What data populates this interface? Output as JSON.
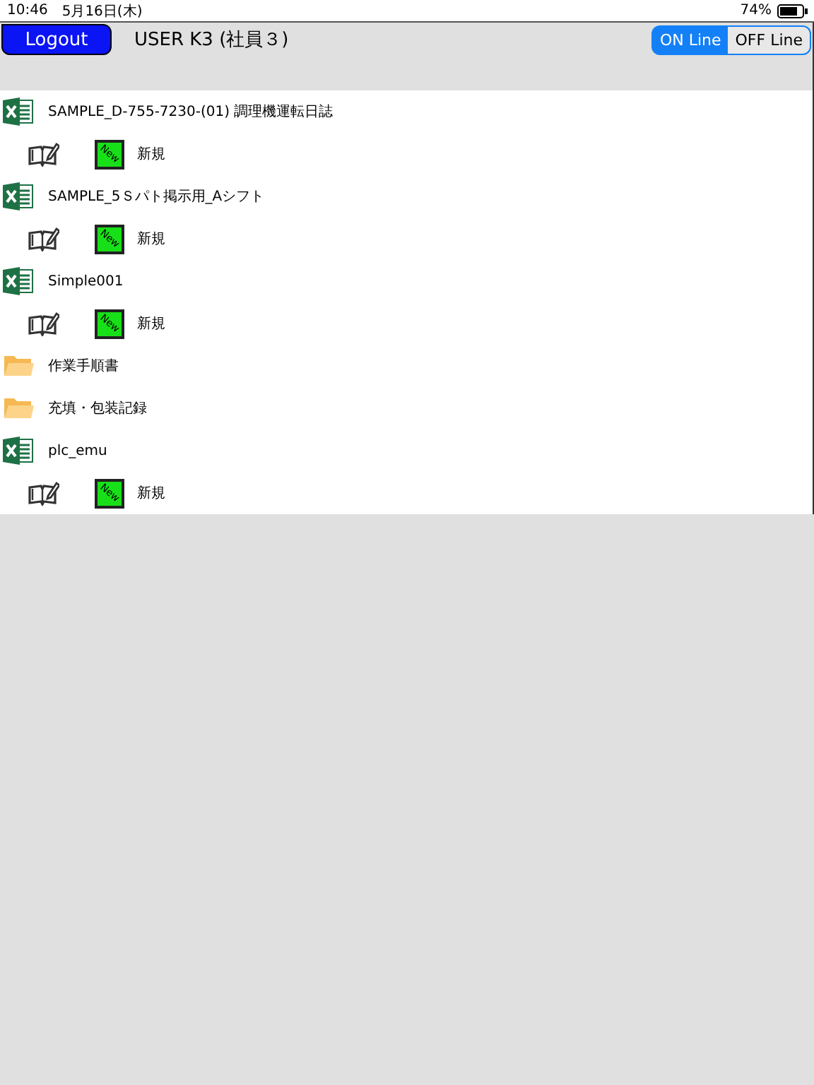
{
  "status_bar": {
    "time": "10:46",
    "date": "5月16日(木)",
    "battery": "74%"
  },
  "header": {
    "logout": "Logout",
    "user": "USER K3 (社員３)",
    "mode_tabs": [
      {
        "label": "ON Line",
        "selected": true
      },
      {
        "label": "OFF Line",
        "selected": false
      }
    ]
  },
  "items": [
    {
      "kind": "file",
      "name": "SAMPLE_D-755-7230-(01) 調理機運転日誌",
      "badge": "New",
      "action": "新規"
    },
    {
      "kind": "file",
      "name": "SAMPLE_5Ｓパト掲示用_Aシフト",
      "badge": "New",
      "action": "新規"
    },
    {
      "kind": "file",
      "name": "Simple001",
      "badge": "New",
      "action": "新規"
    },
    {
      "kind": "folder",
      "name": "作業手順書"
    },
    {
      "kind": "folder",
      "name": "充填・包装記録"
    },
    {
      "kind": "file",
      "name": "plc_emu",
      "badge": "New",
      "action": "新規"
    }
  ]
}
